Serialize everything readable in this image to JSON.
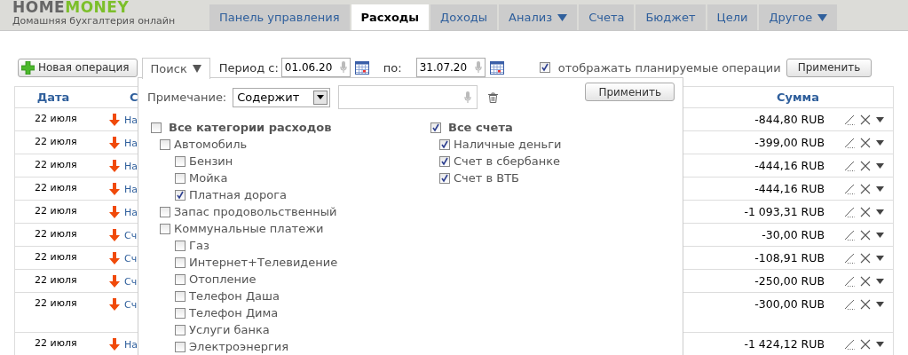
{
  "header": {
    "logo_part_1": "HOME",
    "logo_part_2": "MONEY",
    "tagline": "Домашняя бухгалтерия онлайн"
  },
  "tabs": [
    {
      "label": "Панель управления",
      "selected": false,
      "dropdown": false
    },
    {
      "label": "Расходы",
      "selected": true,
      "dropdown": false
    },
    {
      "label": "Доходы",
      "selected": false,
      "dropdown": false
    },
    {
      "label": "Анализ",
      "selected": false,
      "dropdown": true
    },
    {
      "label": "Счета",
      "selected": false,
      "dropdown": false
    },
    {
      "label": "Бюджет",
      "selected": false,
      "dropdown": false
    },
    {
      "label": "Цели",
      "selected": false,
      "dropdown": false
    },
    {
      "label": "Другое",
      "selected": false,
      "dropdown": true
    }
  ],
  "toolbar": {
    "new_button": "Новая операция",
    "search_tab": "Поиск",
    "period_from_label": "Период с:",
    "period_from": "01.06.20",
    "period_to_label": "по:",
    "period_to": "31.07.20",
    "show_planned": {
      "label": "отображать планируемые операции",
      "checked": true
    },
    "apply_button": "Применить"
  },
  "search_popup": {
    "note_label": "Примечание:",
    "note_mode": "Содержит",
    "apply_button": "Применить",
    "categories": [
      {
        "label": "Все категории расходов",
        "checked": false,
        "children": [
          {
            "label": "Автомобиль",
            "checked": false,
            "children": [
              {
                "label": "Бензин",
                "checked": false
              },
              {
                "label": "Мойка",
                "checked": false
              },
              {
                "label": "Платная дорога",
                "checked": true
              }
            ]
          },
          {
            "label": "Запас продовольственный",
            "checked": false
          },
          {
            "label": "Коммунальные платежи",
            "checked": false,
            "children": [
              {
                "label": "Газ",
                "checked": false
              },
              {
                "label": "Интернет+Телевидение",
                "checked": false
              },
              {
                "label": "Отопление",
                "checked": false
              },
              {
                "label": "Телефон Даша",
                "checked": false
              },
              {
                "label": "Телефон Дима",
                "checked": false
              },
              {
                "label": "Услуги банка",
                "checked": false
              },
              {
                "label": "Электроэнергия",
                "checked": false
              }
            ]
          }
        ]
      }
    ],
    "accounts": [
      {
        "label": "Все счета",
        "checked": true,
        "children": [
          {
            "label": "Наличные деньги",
            "checked": true
          },
          {
            "label": "Счет в сбербанке",
            "checked": true
          },
          {
            "label": "Счет в ВТБ",
            "checked": true
          }
        ]
      }
    ]
  },
  "table": {
    "columns": [
      "Дата",
      "С",
      "Сумма"
    ],
    "rows": [
      {
        "date": "22 июля",
        "text": "На",
        "amount": "-844,80 RUB",
        "tall": false
      },
      {
        "date": "22 июля",
        "text": "На",
        "amount": "-399,00 RUB",
        "tall": false
      },
      {
        "date": "22 июля",
        "text": "На",
        "amount": "-444,16 RUB",
        "tall": false
      },
      {
        "date": "22 июля",
        "text": "На",
        "amount": "-444,16 RUB",
        "tall": false
      },
      {
        "date": "22 июля",
        "text": "На",
        "amount": "-1 093,31 RUB",
        "tall": false
      },
      {
        "date": "22 июля",
        "text": "Сч",
        "amount": "-30,00 RUB",
        "tall": false
      },
      {
        "date": "22 июля",
        "text": "Сч",
        "amount": "-108,91 RUB",
        "tall": false
      },
      {
        "date": "22 июля",
        "text": "Сч",
        "amount": "-250,00 RUB",
        "tall": false
      },
      {
        "date": "22 июля",
        "text": "Сч",
        "amount": "-300,00 RUB",
        "tall": true
      },
      {
        "date": "22 июля",
        "text": "На",
        "amount": "-1 424,12 RUB",
        "tall": false
      }
    ]
  }
}
